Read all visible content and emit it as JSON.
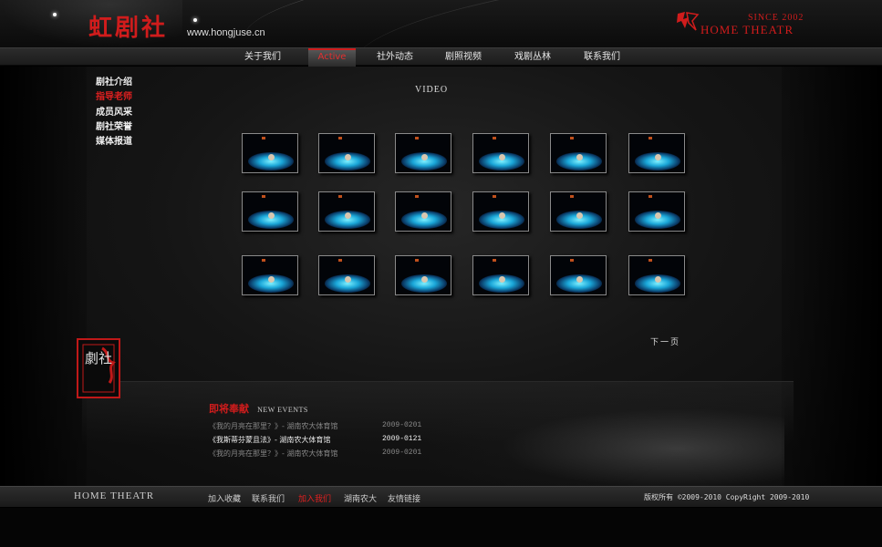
{
  "header": {
    "logo": "虹剧社",
    "url": "www.hongjuse.cn",
    "since": "SINCE 2002",
    "brand": "HOME THEATR"
  },
  "nav": [
    {
      "label": "关于我们",
      "active": false
    },
    {
      "label": "Active",
      "active": true
    },
    {
      "label": "社外动态",
      "active": false
    },
    {
      "label": "剧照视频",
      "active": false
    },
    {
      "label": "戏剧丛林",
      "active": false
    },
    {
      "label": "联系我们",
      "active": false
    }
  ],
  "sidebar": {
    "items": [
      {
        "label": "剧社介绍",
        "active": false
      },
      {
        "label": "指导老师",
        "active": true
      },
      {
        "label": "成员风采",
        "active": false
      },
      {
        "label": "剧社荣誉",
        "active": false
      },
      {
        "label": "媒体报道",
        "active": false
      }
    ]
  },
  "content": {
    "title": "VIDEO",
    "thumbnail_count": 18,
    "next_page": "下一页"
  },
  "seal": {
    "text": "劇社"
  },
  "events": {
    "title_cn": "即将奉献",
    "title_en": "NEW EVENTS",
    "items": [
      {
        "title": "《我的月亮在那里？》- 湖南农大体育馆",
        "date": "2009-0201",
        "highlight": false
      },
      {
        "title": "《我斯蒂芬蒙且法》- 湖南农大体育馆",
        "date": "2009-0121",
        "highlight": true
      },
      {
        "title": "《我的月亮在那里？》- 湖南农大体育馆",
        "date": "2009-0201",
        "highlight": false
      }
    ]
  },
  "footer": {
    "brand": "HOME THEATR",
    "links": [
      {
        "label": "加入收藏",
        "active": false
      },
      {
        "label": "联系我们",
        "active": false
      },
      {
        "label": "加入我们",
        "active": true
      },
      {
        "label": "湖南农大",
        "active": false
      },
      {
        "label": "友情链接",
        "active": false
      }
    ],
    "copyright": "版权所有 ©2009-2010  CopyRight 2009-2010"
  },
  "colors": {
    "accent": "#d01c1c",
    "background": "#000000"
  }
}
